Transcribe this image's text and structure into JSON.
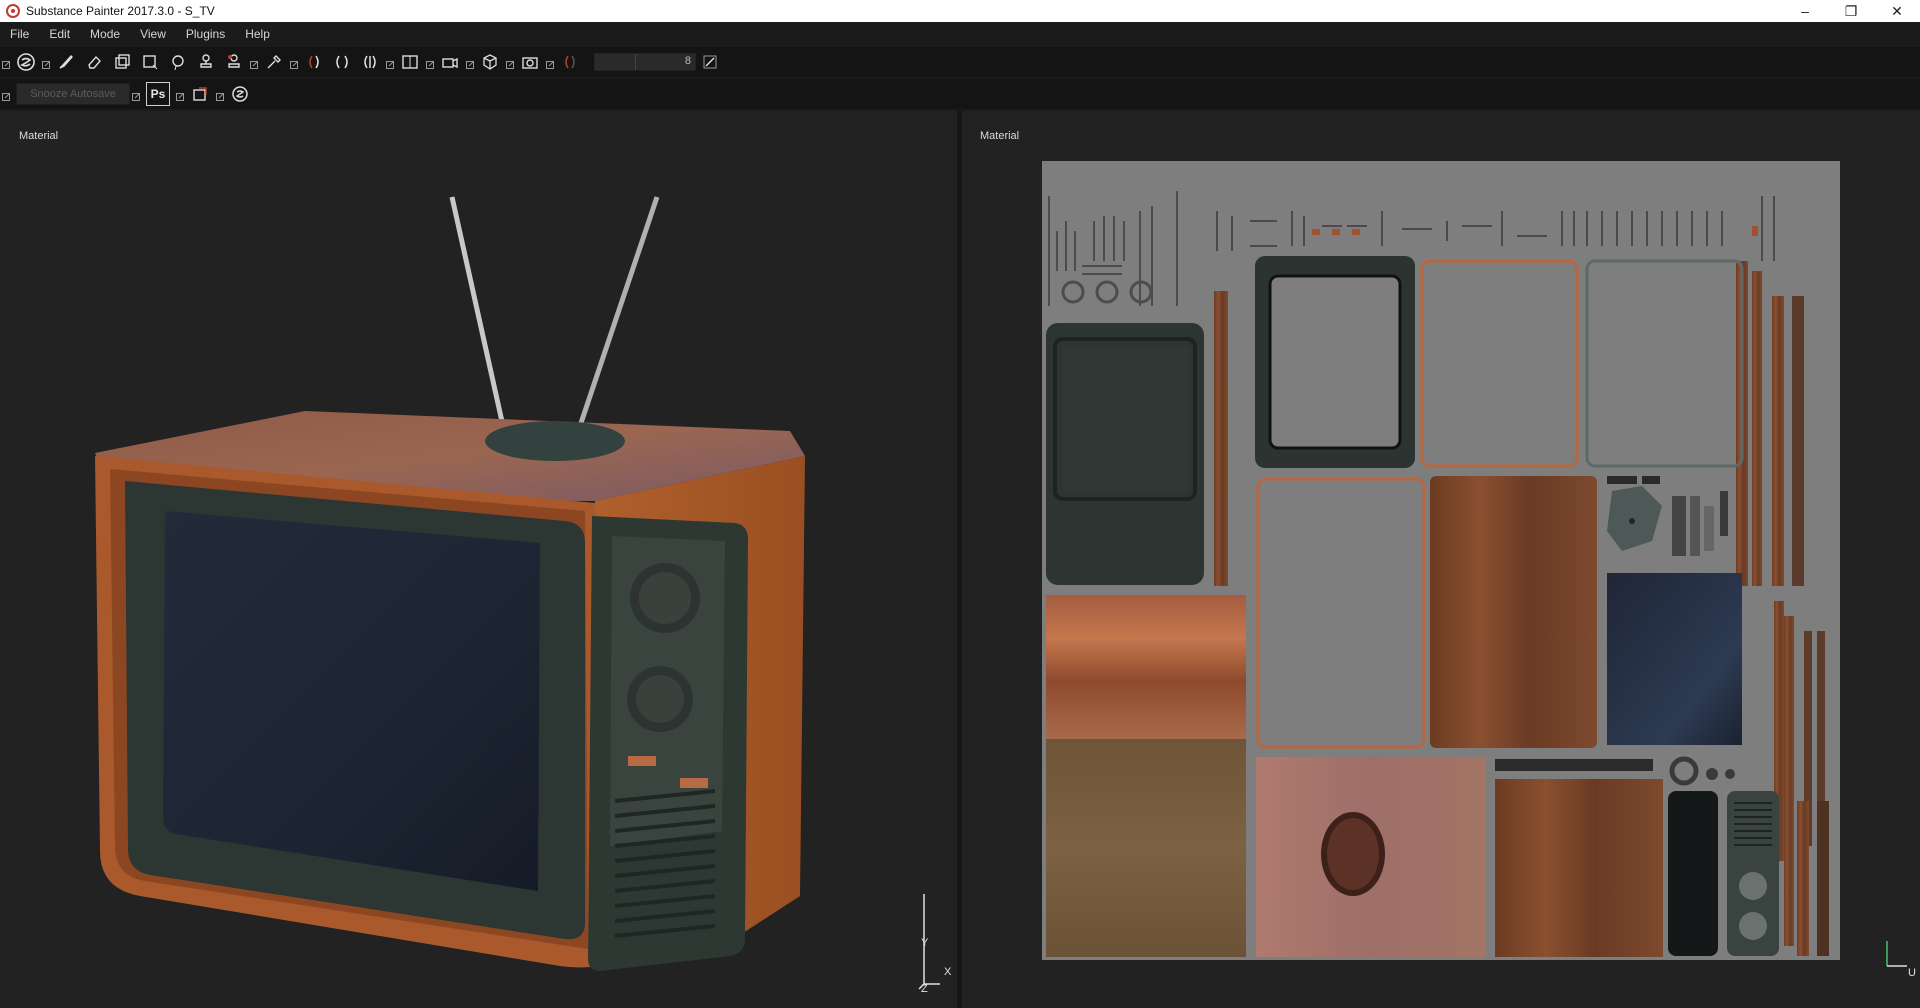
{
  "window": {
    "title": "Substance Painter 2017.3.0 - S_TV",
    "controls": [
      "–",
      "❐",
      "✕"
    ]
  },
  "menu": [
    "File",
    "Edit",
    "Mode",
    "View",
    "Plugins",
    "Help"
  ],
  "toolbar": {
    "brush_size_value": "8",
    "snooze_label": "Snooze Autosave",
    "photoshop_label": "Ps"
  },
  "viewports": {
    "left": {
      "label": "Material",
      "axis_y": "Y",
      "axis_x": "X",
      "axis_z": "Z"
    },
    "right": {
      "label": "Material",
      "axis_u": "U"
    }
  },
  "colors": {
    "background": "#222222",
    "wood": "#a8552b",
    "wood_dark": "#6b3a22",
    "plastic": "#2f3a36",
    "screen": "#1c2432",
    "uv_background": "#7e7e7e",
    "metal": "#bfbfbf"
  }
}
